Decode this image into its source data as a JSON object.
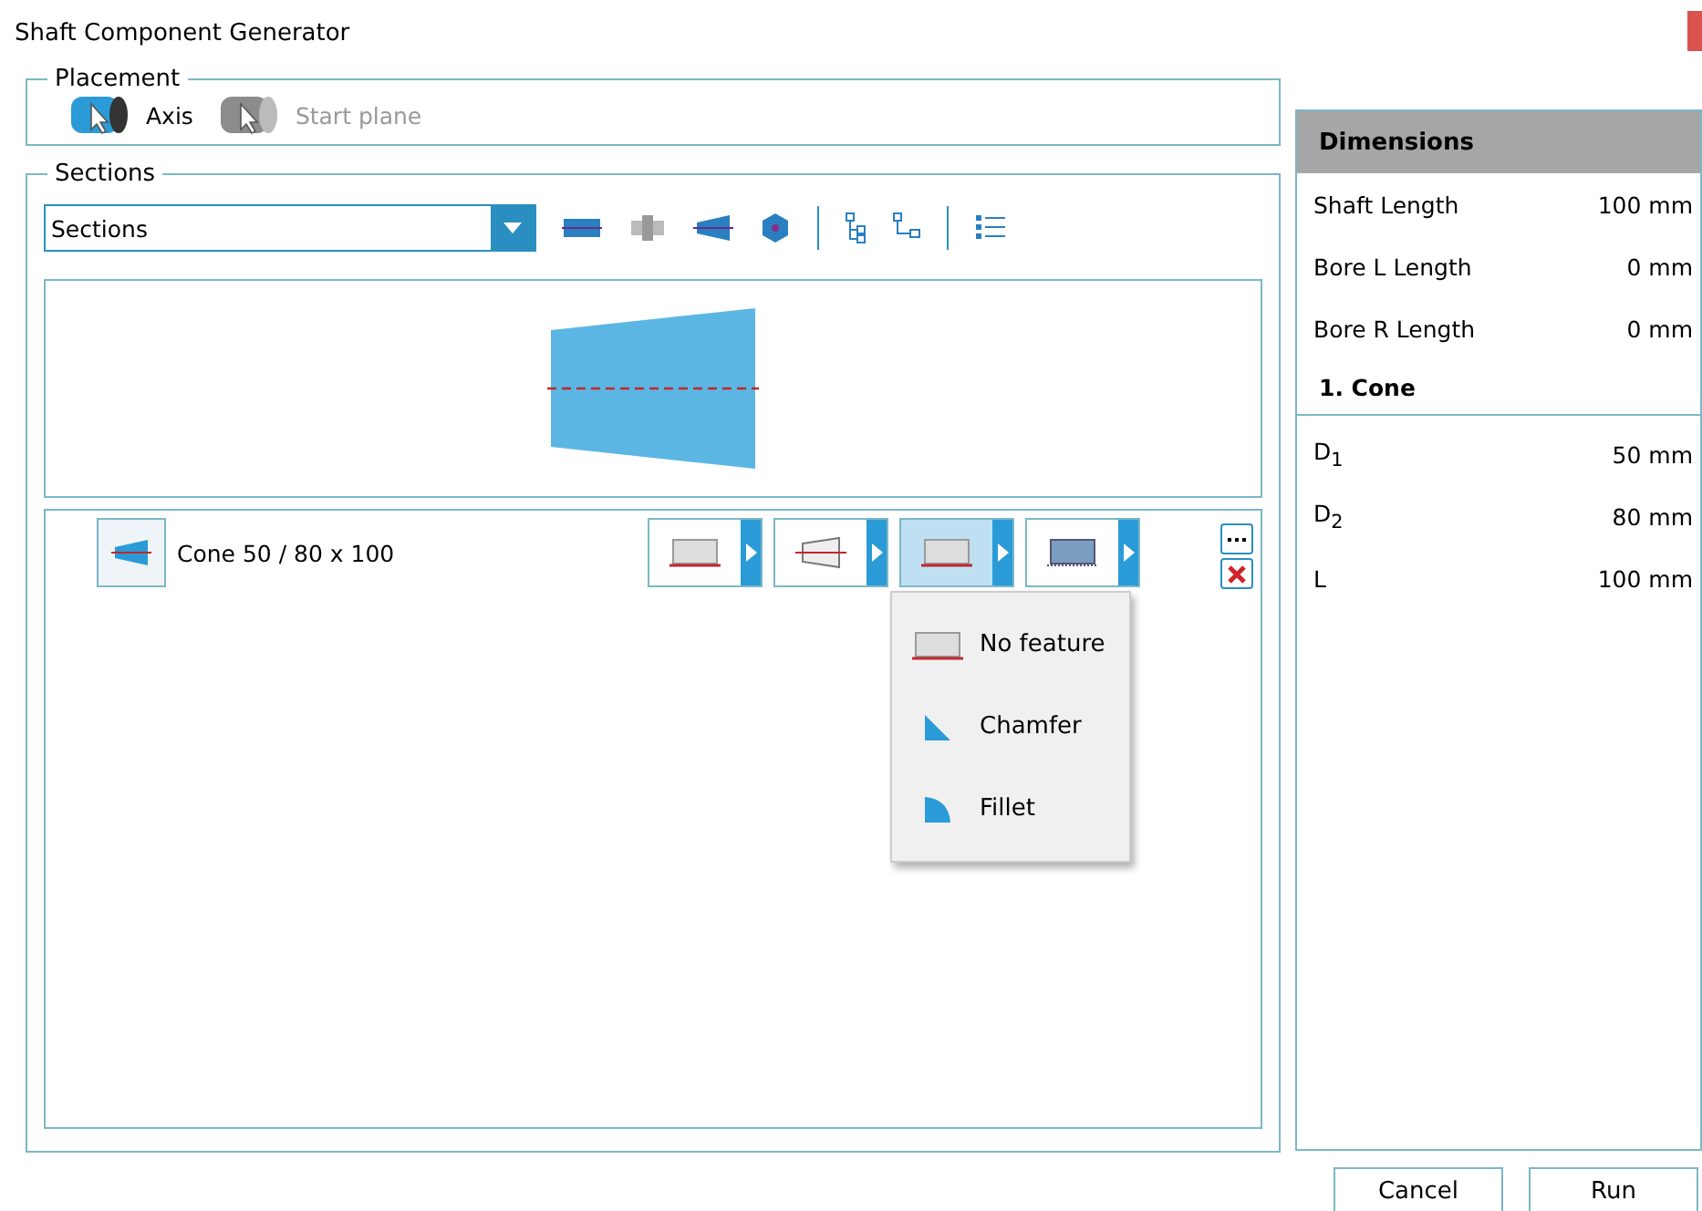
{
  "window": {
    "title": "Shaft Component Generator"
  },
  "placement": {
    "label": "Placement",
    "options": [
      {
        "label": "Axis",
        "selected": true
      },
      {
        "label": "Start plane",
        "selected": false
      }
    ]
  },
  "sections": {
    "label": "Sections",
    "dropdown": {
      "value": "Sections"
    },
    "row": {
      "label": "Cone 50 / 80 x 100",
      "features": [
        {
          "kind": "plain",
          "selected": false
        },
        {
          "kind": "cone",
          "selected": false
        },
        {
          "kind": "plain",
          "selected": true
        },
        {
          "kind": "hatched",
          "selected": false
        }
      ],
      "menu": [
        {
          "kind": "none",
          "label": "No feature"
        },
        {
          "kind": "chamfer",
          "label": "Chamfer"
        },
        {
          "kind": "fillet",
          "label": "Fillet"
        }
      ]
    }
  },
  "dimensions": {
    "title": "Dimensions",
    "rows": [
      {
        "label": "Shaft Length",
        "value": "100 mm"
      },
      {
        "label": "Bore L Length",
        "value": "0 mm"
      },
      {
        "label": "Bore R Length",
        "value": "0 mm"
      }
    ],
    "section_title": "1. Cone",
    "section_rows": [
      {
        "label": "D$_{1}$",
        "value": "50 mm"
      },
      {
        "label": "D$_{2}$",
        "value": "80 mm"
      },
      {
        "label": "L",
        "value": "100 mm"
      }
    ]
  },
  "buttons": [
    "Cancel",
    "Run"
  ]
}
